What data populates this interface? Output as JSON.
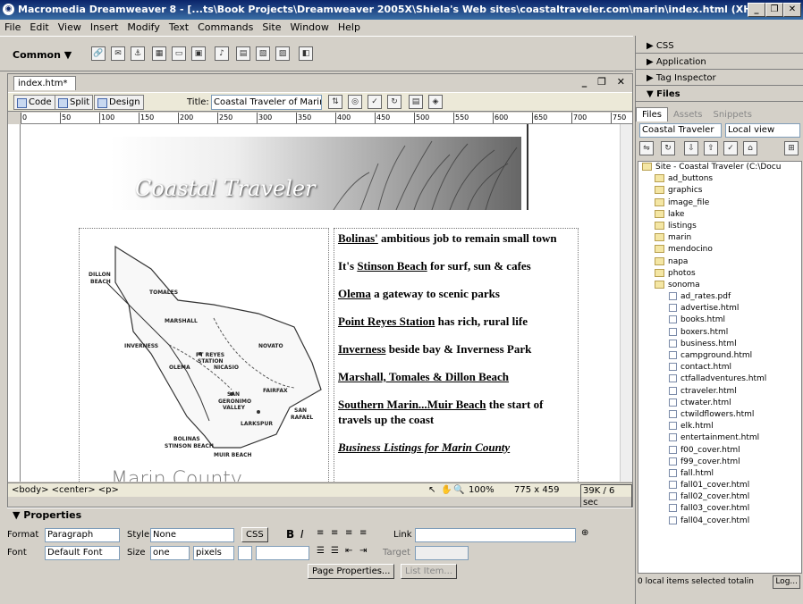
{
  "window": {
    "title": "Macromedia Dreamweaver 8 - [...ts\\Book Projects\\Dreamweaver 2005X\\Shiela's Web sites\\coastaltraveler.com\\marin\\index.html (XHTML)*]",
    "btn_min": "_",
    "btn_max": "❐",
    "btn_close": "✕"
  },
  "menu": [
    "File",
    "Edit",
    "View",
    "Insert",
    "Modify",
    "Text",
    "Commands",
    "Site",
    "Window",
    "Help"
  ],
  "insert_bar": {
    "category": "Common ▼"
  },
  "document": {
    "tab": "index.htm*",
    "controls": "_ ❐ ✕",
    "views": {
      "code": "Code",
      "split": "Split",
      "design": "Design"
    },
    "title_label": "Title:",
    "title_value": "Coastal Traveler of Marin Cour",
    "ruler_marks": [
      "0",
      "50",
      "100",
      "150",
      "200",
      "250",
      "300",
      "350",
      "400",
      "450",
      "500",
      "550",
      "600",
      "650",
      "700",
      "750"
    ],
    "banner_title": "Coastal Traveler",
    "map_title": "Marin County",
    "map_labels": [
      "DILLON",
      "BEACH",
      "TOMALES",
      "MARSHALL",
      "INVERNESS",
      "PT REYES",
      "STATION",
      "NOVATO",
      "OLEMA",
      "NICASIO",
      "FAIRFAX",
      "SAN",
      "GERONIMO",
      "VALLEY",
      "SAN",
      "RAFAEL",
      "LARKSPUR",
      "BOLINAS",
      "STINSON BEACH",
      "MUIR BEACH"
    ],
    "links": [
      {
        "link": "Bolinas'",
        "rest": " ambitious job to remain small town"
      },
      {
        "pre": "It's ",
        "link": "Stinson Beach",
        "rest": " for surf, sun & cafes"
      },
      {
        "link": "Olema",
        "rest": " a gateway to scenic parks"
      },
      {
        "link": "Point Reyes Station",
        "rest": " has rich, rural life"
      },
      {
        "link": "Inverness",
        "rest": " beside bay & Inverness Park"
      },
      {
        "link": "Marshall, Tomales & Dillon Beach",
        "rest": ""
      },
      {
        "link": "Southern Marin...Muir Beach",
        "rest": " the start of travels up the coast"
      },
      {
        "link": "Business Listings for Marin County",
        "rest": "",
        "italic": true
      }
    ],
    "status": {
      "tags": "<body> <center> <p>",
      "zoom": "100%",
      "dimensions": "775 x 459",
      "download": "39K / 6 sec"
    }
  },
  "properties": {
    "header": "▼ Properties",
    "format_label": "Format",
    "format_value": "Paragraph",
    "style_label": "Style",
    "style_value": "None",
    "css_button": "CSS",
    "bold": "B",
    "italic": "I",
    "link_label": "Link",
    "font_label": "Font",
    "font_value": "Default Font",
    "size_label": "Size",
    "size_value": "one",
    "units_value": "pixels",
    "target_label": "Target",
    "page_properties": "Page Properties...",
    "list_item": "List Item..."
  },
  "panels": {
    "css": "▶ CSS",
    "application": "▶ Application",
    "tag_inspector": "▶ Tag Inspector",
    "files": "▼ Files",
    "tabs": [
      "Files",
      "Assets",
      "Snippets"
    ],
    "site": "Coastal Traveler",
    "view": "Local view",
    "tree": [
      {
        "name": "Site - Coastal Traveler (C:\\Docu",
        "type": "root"
      },
      {
        "name": "ad_buttons",
        "type": "folder"
      },
      {
        "name": "graphics",
        "type": "folder"
      },
      {
        "name": "image_file",
        "type": "folder"
      },
      {
        "name": "lake",
        "type": "folder"
      },
      {
        "name": "listings",
        "type": "folder"
      },
      {
        "name": "marin",
        "type": "folder"
      },
      {
        "name": "mendocino",
        "type": "folder"
      },
      {
        "name": "napa",
        "type": "folder"
      },
      {
        "name": "photos",
        "type": "folder"
      },
      {
        "name": "sonoma",
        "type": "folder"
      },
      {
        "name": "ad_rates.pdf",
        "type": "file"
      },
      {
        "name": "advertise.html",
        "type": "file"
      },
      {
        "name": "books.html",
        "type": "file"
      },
      {
        "name": "boxers.html",
        "type": "file"
      },
      {
        "name": "business.html",
        "type": "file"
      },
      {
        "name": "campground.html",
        "type": "file"
      },
      {
        "name": "contact.html",
        "type": "file"
      },
      {
        "name": "ctfalladventures.html",
        "type": "file"
      },
      {
        "name": "ctraveler.html",
        "type": "file"
      },
      {
        "name": "ctwater.html",
        "type": "file"
      },
      {
        "name": "ctwildflowers.html",
        "type": "file"
      },
      {
        "name": "elk.html",
        "type": "file"
      },
      {
        "name": "entertainment.html",
        "type": "file"
      },
      {
        "name": "f00_cover.html",
        "type": "file"
      },
      {
        "name": "f99_cover.html",
        "type": "file"
      },
      {
        "name": "fall.html",
        "type": "file"
      },
      {
        "name": "fall01_cover.html",
        "type": "file"
      },
      {
        "name": "fall02_cover.html",
        "type": "file"
      },
      {
        "name": "fall03_cover.html",
        "type": "file"
      },
      {
        "name": "fall04_cover.html",
        "type": "file"
      }
    ],
    "status": "0 local items selected totalin",
    "log": "Log..."
  }
}
